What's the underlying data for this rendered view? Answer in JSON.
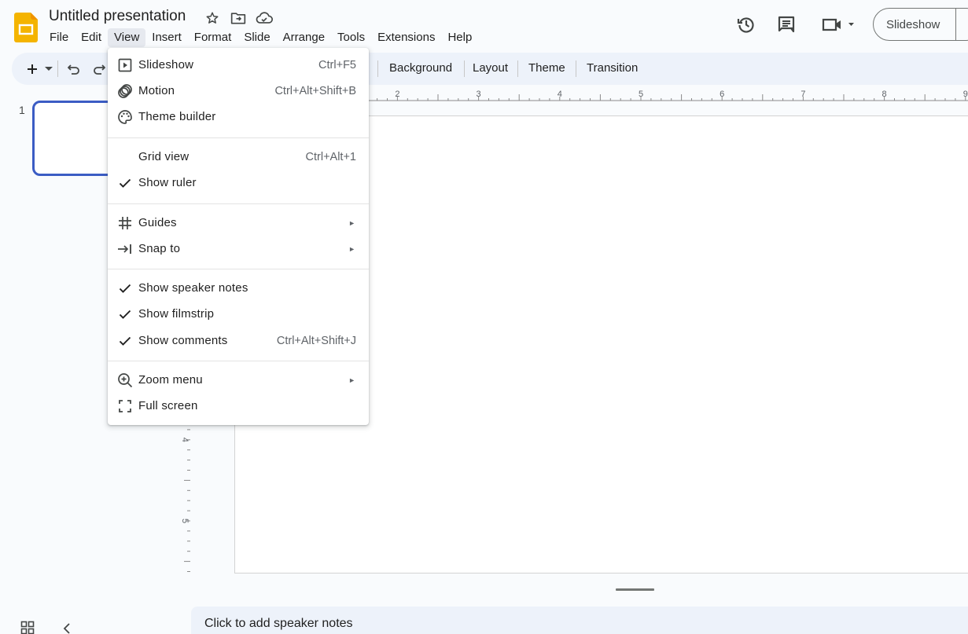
{
  "app": {
    "title": "Untitled presentation",
    "brand_color": "#f4b400"
  },
  "menubar": {
    "items": [
      "File",
      "Edit",
      "View",
      "Insert",
      "Format",
      "Slide",
      "Arrange",
      "Tools",
      "Extensions",
      "Help"
    ],
    "active": "View"
  },
  "header_actions": {
    "slideshow_label": "Slideshow",
    "icons": [
      "version-history-icon",
      "comments-icon",
      "meet-icon"
    ]
  },
  "toolbar": {
    "buttons": [
      "Background",
      "Layout",
      "Theme",
      "Transition"
    ]
  },
  "ruler": {
    "horizontal_labels": [
      "2",
      "3",
      "4",
      "5",
      "6",
      "7",
      "8",
      "9"
    ],
    "vertical_labels": [
      "4",
      "5"
    ]
  },
  "filmstrip": {
    "slide_number": "1"
  },
  "notes": {
    "placeholder": "Click to add speaker notes"
  },
  "view_menu": {
    "items": [
      {
        "label": "Slideshow",
        "shortcut": "Ctrl+F5",
        "icon": "slideshow-icon"
      },
      {
        "label": "Motion",
        "shortcut": "Ctrl+Alt+Shift+B",
        "icon": "motion-icon"
      },
      {
        "label": "Theme builder",
        "shortcut": "",
        "icon": "palette-icon"
      },
      {
        "label": "Grid view",
        "shortcut": "Ctrl+Alt+1",
        "icon": ""
      },
      {
        "label": "Show ruler",
        "shortcut": "",
        "checked": true
      },
      {
        "label": "Guides",
        "submenu": true,
        "icon": "guides-icon"
      },
      {
        "label": "Snap to",
        "submenu": true,
        "icon": "snap-icon"
      },
      {
        "label": "Show speaker notes",
        "shortcut": "",
        "checked": true
      },
      {
        "label": "Show filmstrip",
        "shortcut": "",
        "checked": true
      },
      {
        "label": "Show comments",
        "shortcut": "Ctrl+Alt+Shift+J",
        "checked": true
      },
      {
        "label": "Zoom menu",
        "submenu": true,
        "icon": "zoom-in-icon"
      },
      {
        "label": "Full screen",
        "shortcut": "",
        "icon": "fullscreen-icon"
      }
    ]
  }
}
